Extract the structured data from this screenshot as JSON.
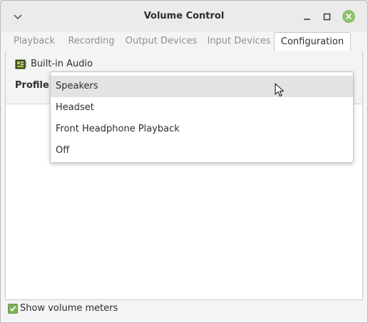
{
  "window": {
    "title": "Volume Control"
  },
  "tabs": [
    {
      "label": "Playback",
      "active": false
    },
    {
      "label": "Recording",
      "active": false
    },
    {
      "label": "Output Devices",
      "active": false
    },
    {
      "label": "Input Devices",
      "active": false
    },
    {
      "label": "Configuration",
      "active": true
    }
  ],
  "configuration": {
    "card_name": "Built-in Audio",
    "profile_label": "Profile:",
    "profile_options": [
      {
        "label": "Speakers",
        "highlighted": true
      },
      {
        "label": "Headset",
        "highlighted": false
      },
      {
        "label": "Front Headphone Playback",
        "highlighted": false
      },
      {
        "label": "Off",
        "highlighted": false
      }
    ]
  },
  "footer": {
    "show_meters_label": "Show volume meters",
    "show_meters_checked": true
  },
  "colors": {
    "accent_green": "#7eb158",
    "close_button": "#8fc16a",
    "highlight": "#e3e3e3"
  }
}
